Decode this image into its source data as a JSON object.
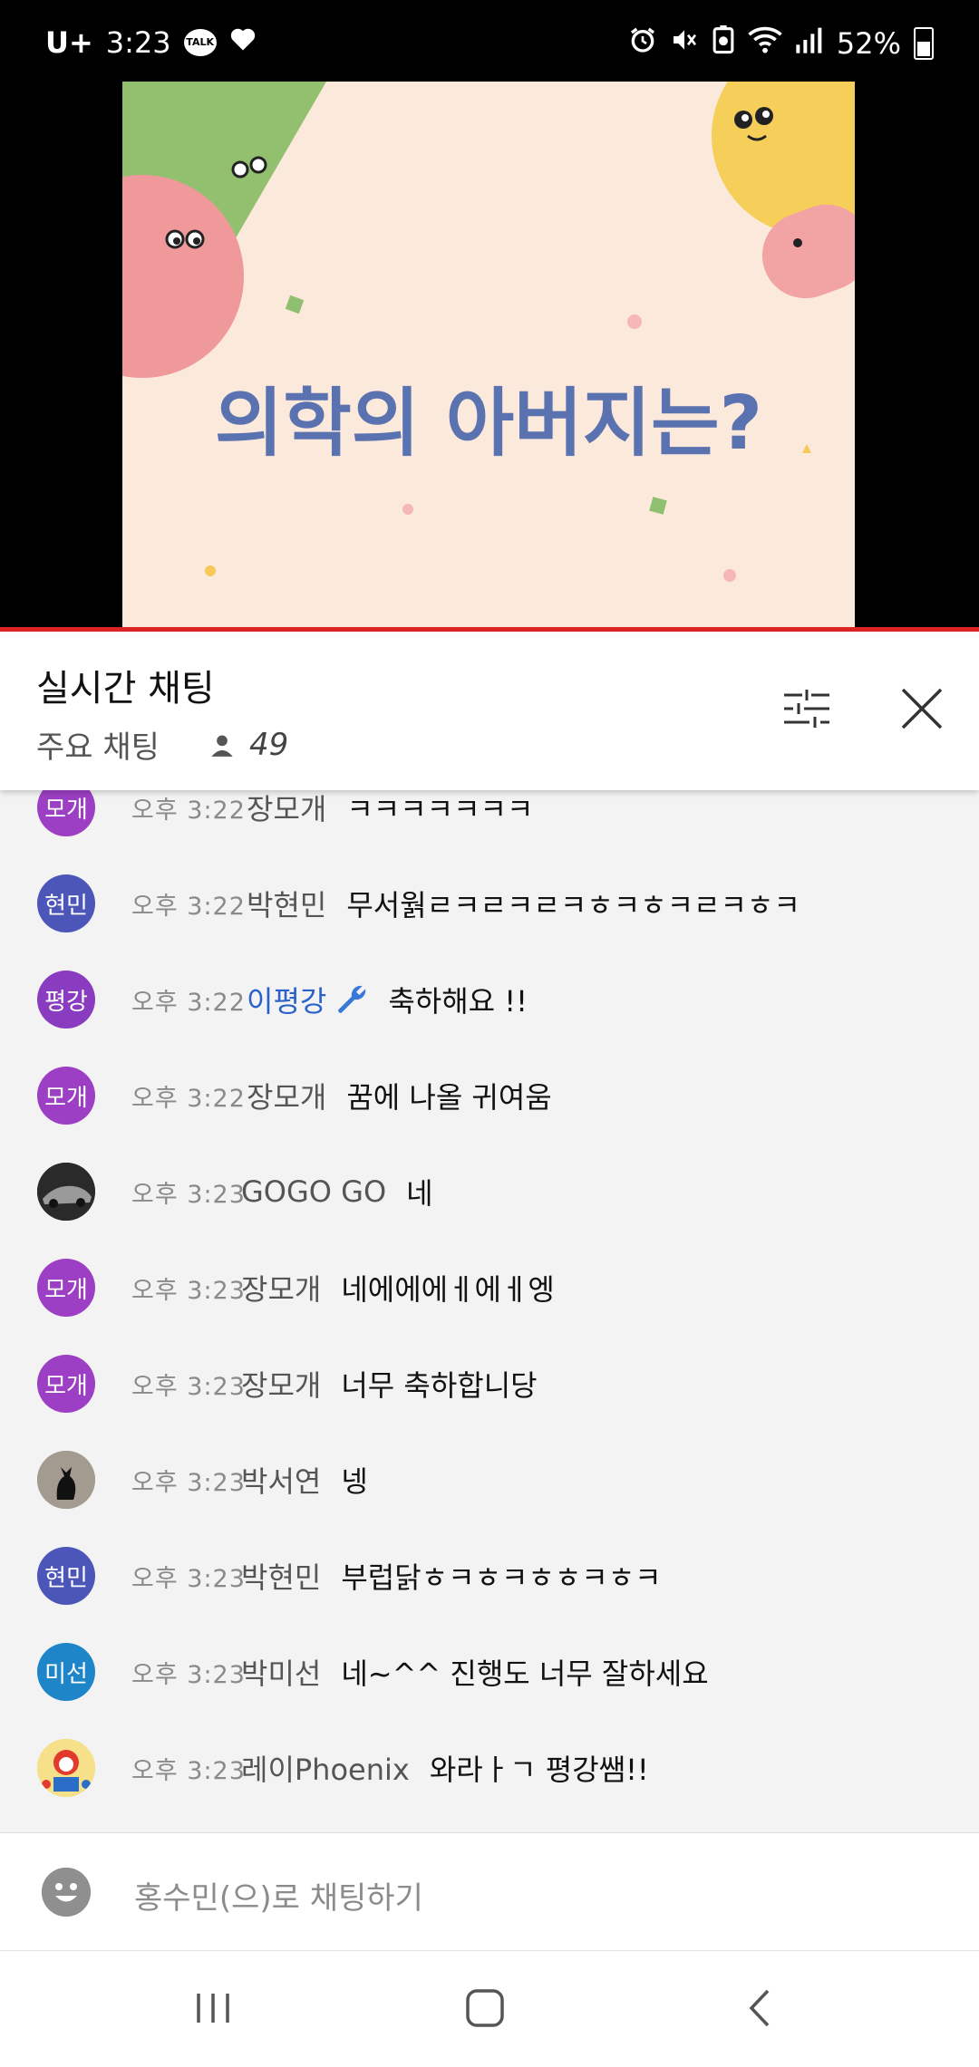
{
  "status_bar": {
    "carrier": "U+",
    "time": "3:23",
    "talk_badge": "TALK",
    "battery_percent": "52%",
    "icons": [
      "talk-icon",
      "heart-icon",
      "alarm-icon",
      "mute-icon",
      "battery-saver-icon",
      "wifi-icon",
      "signal-icon",
      "battery-icon"
    ]
  },
  "video": {
    "thumbnail_text": "의학의 아버지는?",
    "progress_color": "#e02424"
  },
  "chat_header": {
    "title": "실시간 채팅",
    "mode_label": "주요 채팅",
    "viewer_count": "49"
  },
  "messages": [
    {
      "avatar_text": "모개",
      "avatar_color": "#9c3fc4",
      "time": "오후 3:22",
      "author": "장모개",
      "text": "ㅋㅋㅋㅋㅋㅋㅋ",
      "owner": false
    },
    {
      "avatar_text": "현민",
      "avatar_color": "#4b56b8",
      "time": "오후 3:22",
      "author": "박현민",
      "text": "무서웕ㄹㅋㄹㅋㄹㅋㅎㅋㅎㅋㄹㅋㅎㅋ",
      "owner": false
    },
    {
      "avatar_text": "평강",
      "avatar_color": "#8a3cc0",
      "time": "오후 3:22",
      "author": "이평강",
      "text": "축하해요 !!",
      "owner": true
    },
    {
      "avatar_text": "모개",
      "avatar_color": "#9c3fc4",
      "time": "오후 3:22",
      "author": "장모개",
      "text": "꿈에 나올 귀여움",
      "owner": false
    },
    {
      "avatar_text": "",
      "avatar_color": "#1c1c1c",
      "time": "오후 3:23",
      "author": "GOGO GO",
      "text": "네",
      "owner": false
    },
    {
      "avatar_text": "모개",
      "avatar_color": "#9c3fc4",
      "time": "오후 3:23",
      "author": "장모개",
      "text": "네에에에ㅔ에ㅔ엥",
      "owner": false
    },
    {
      "avatar_text": "모개",
      "avatar_color": "#9c3fc4",
      "time": "오후 3:23",
      "author": "장모개",
      "text": "너무 축하합니당",
      "owner": false
    },
    {
      "avatar_text": "",
      "avatar_color": "#9e958c",
      "time": "오후 3:23",
      "author": "박서연",
      "text": "넹",
      "owner": false
    },
    {
      "avatar_text": "현민",
      "avatar_color": "#4b56b8",
      "time": "오후 3:23",
      "author": "박현민",
      "text": "부럽닭ㅎㅋㅎㅋㅎㅎㅋㅎㅋ",
      "owner": false
    },
    {
      "avatar_text": "미선",
      "avatar_color": "#1e86c8",
      "time": "오후 3:23",
      "author": "박미선",
      "text": "네~^^ 진행도 너무 잘하세요",
      "owner": false
    },
    {
      "avatar_text": "",
      "avatar_color": "#f5d04a",
      "time": "오후 3:23",
      "author": "레이Phoenix",
      "text": "와라ㅏㄱ 평강쌤!!",
      "owner": false
    }
  ],
  "chat_input": {
    "placeholder": "홍수민(으)로 채팅하기"
  },
  "nav_bar": {
    "icons": [
      "recents-icon",
      "home-icon",
      "back-icon"
    ]
  }
}
